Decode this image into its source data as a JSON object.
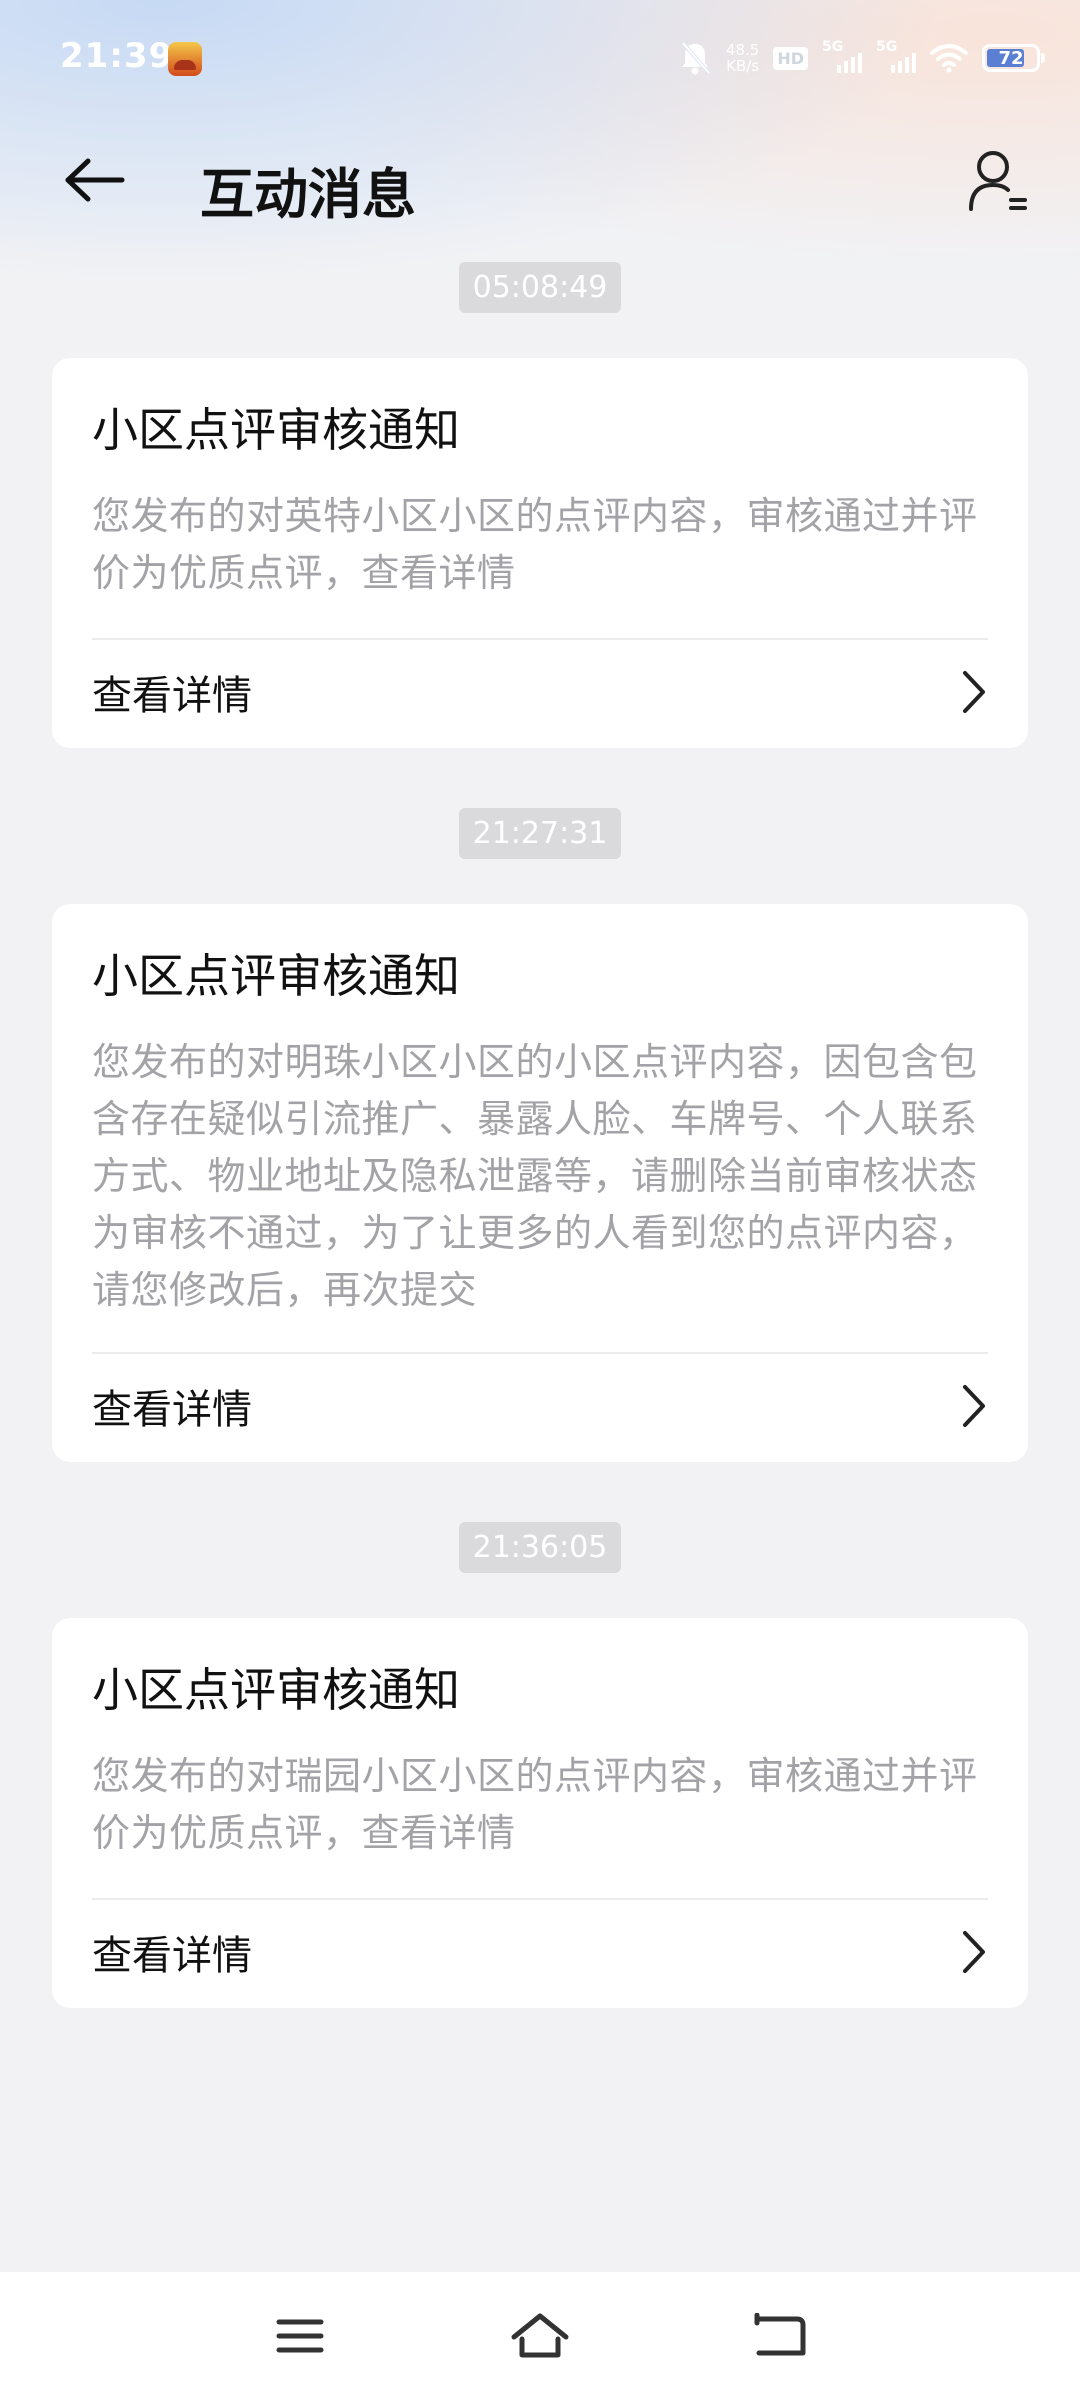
{
  "status_bar": {
    "time": "21:39",
    "net_speed_value": "48.5",
    "net_speed_unit": "KB/s",
    "hd_label": "HD",
    "signal_1_label": "5G",
    "signal_2_label": "5G",
    "battery_level": "72"
  },
  "header": {
    "title": "互动消息"
  },
  "messages": [
    {
      "timestamp": "05:08:49",
      "title": "小区点评审核通知",
      "body": "您发布的对英特小区小区的点评内容，审核通过并评价为优质点评，查看详情",
      "action_label": "查看详情"
    },
    {
      "timestamp": "21:27:31",
      "title": "小区点评审核通知",
      "body": "您发布的对明珠小区小区的小区点评内容，因包含包含存在疑似引流推广、暴露人脸、车牌号、个人联系方式、物业地址及隐私泄露等，请删除当前审核状态为审核不通过，为了让更多的人看到您的点评内容，请您修改后，再次提交",
      "action_label": "查看详情"
    },
    {
      "timestamp": "21:36:05",
      "title": "小区点评审核通知",
      "body": "您发布的对瑞园小区小区的点评内容，审核通过并评价为优质点评，查看详情",
      "action_label": "查看详情"
    }
  ],
  "icons": {
    "back": "arrow-left-icon",
    "profile": "user-list-icon",
    "chevron": "chevron-right-icon",
    "nav_menu": "menu-icon",
    "nav_home": "home-icon",
    "nav_back": "return-icon"
  }
}
